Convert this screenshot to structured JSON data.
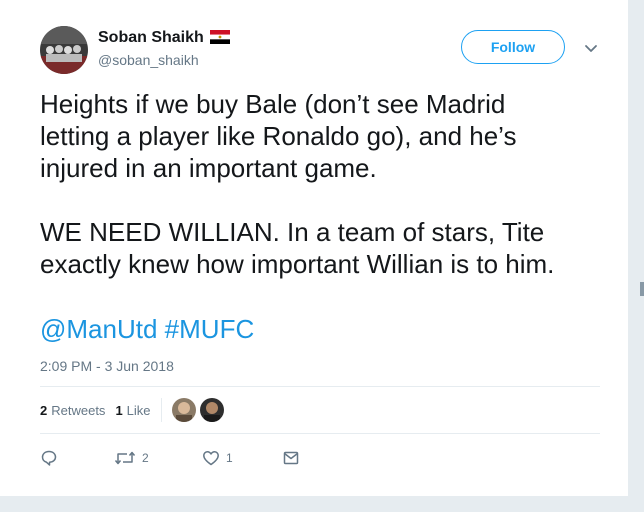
{
  "tweet": {
    "author_name": "Soban Shaikh",
    "author_handle": "@soban_shaikh",
    "follow_label": "Follow",
    "text": "Heights if we buy Bale (don’t see Madrid\nletting a player like Ronaldo go), and he’s\ninjured in an important game.\n\nWE NEED WILLIAN. In a team of stars, Tite\nexactly knew how important Willian is to him.",
    "mentions": [
      "@ManUtd",
      "#MUFC"
    ],
    "timestamp": "2:09 PM - 3 Jun 2018",
    "retweet_count": "2",
    "retweets_label": "Retweets",
    "like_count": "1",
    "like_label": "Like"
  },
  "actions": {
    "retweet_count": "2",
    "like_count": "1"
  },
  "colors": {
    "accent": "#1da1f2",
    "link": "#1b95e0",
    "text": "#14171a",
    "muted": "#657786"
  },
  "icons": {
    "reply": "speech-bubble-icon",
    "retweet": "retweet-icon",
    "like": "heart-icon",
    "dm": "envelope-icon"
  }
}
